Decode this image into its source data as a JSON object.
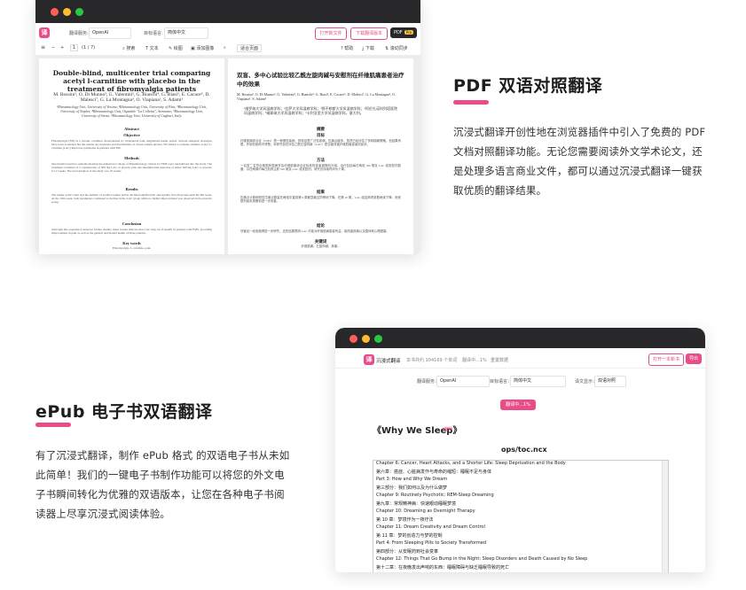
{
  "pdf_window": {
    "toolbar": {
      "service_label": "翻译服务:",
      "service_value": "OpenAI",
      "target_label": "目标语言:",
      "target_value": "简体中文",
      "open_file": "打开新文件",
      "download": "下载翻译版本",
      "pdf_pro": "PDF",
      "pro_badge": "Pro"
    },
    "subbar": {
      "page_current": "1",
      "page_total": "(1 / 7)",
      "tool_search": "搜索",
      "tool_text": "文本",
      "tool_draw": "绘图",
      "tool_highlight": "添加图像",
      "zoom_value": "适合页面",
      "help": "帮助",
      "download_icon_label": "下载",
      "sync": "滚动同步"
    },
    "left_page": {
      "title": "Double-blind, multicenter trial comparing acetyl l-carnitine with placebo in the treatment of fibromyalgia patients",
      "authors": "M. Rossini¹, O. Di Munno², G. Valentini³, G. Bianchi⁴, G. Biasi⁵, E. Cacace⁶, D. Malesci⁷, G. La Montagna³, O. Viapiana¹, S. Adami¹",
      "affiliations": "¹Rheumatology Unit, University of Verona; ²Rheumatology Unit, University of Pisa; ³Rheumatology Unit, University of Naples; ⁴Rheumatology Unit, Ospedale \"La Colletta\", Arenzano; ⁵Rheumatology Unit, University of Siena; ⁶Rheumatology Unit, University of Cagliari, Italy.",
      "abstract_head": "Abstract",
      "objective_head": "Objective",
      "objective_text": "Fibromyalgia (FM) is a chronic condition characterized by widespread pain, heightened tender points. Several analgesic strategies have been evaluated but the results are moderate and mechanisms of action remain unclear. We aimed to evaluate whether acetyl L-carnitine (LAC) improves symptoms in patients with FM.",
      "methods_head": "Methods",
      "methods_text": "One hundred and two patients meeting the American College of Rheumatology criteria for FMS were randomized into the study. The treatment consisted of 2 capsules/day of 500 mg LAC or placebo plus one intramuscular injection of either 500 mg LAC or placebo for 2 weeks. The total duration of the study was 10 weeks.",
      "results_head": "Results",
      "results_text": "The tender point count and the number of positive tender points declined significantly and equally in both groups until the 6th week. At the 10th week, both parameters continued to decline in the LAC group while no further improvement was observed in the placebo group.",
      "conclusion_head": "Conclusion",
      "conclusion_text": "Although this experience deserves further studies, these results indicate that LAC may be of benefit in patients with FMS, providing improvement in pain as well as the general and mental health of these patients.",
      "keywords_head": "Key words",
      "keywords_text": "Fibromyalgia, L-carnitine, pain."
    },
    "right_page": {
      "title": "双盲、多中心试验比较乙酰左旋肉碱与安慰剂在纤维肌痛患者治疗中的效果",
      "authors": "M. Rossini¹, O. Di Munno², G. Valentini³, G. Bianchi⁴, G. Biasi⁵, E. Cacace⁶, D. Malesci⁷, G. La Montagna³, O. Viapiana¹, S. Adami¹",
      "affiliations": "¹维罗纳大学风湿病学科；²比萨大学风湿病学科；³那不勒斯大学风湿病学科；⁴阿伦扎诺科列塔医院风湿病学科；⁵锡耶纳大学风湿病学科；⁶卡利亚里大学风湿病学科，意大利。",
      "abstract_head": "摘要",
      "objective_head": "目标",
      "objective_text": "纤维肌痛综合征（FMS）是一种慢性疾病，其特征是广泛性疼痛、压痛点增多。虽然已经评估了多种镇痛策略，但结果有限，作用机制尚不清楚。本研究旨在评估乙酰左旋肉碱（LAC）是否能改善纤维肌痛患者的症状。",
      "methods_head": "方法",
      "methods_text": "一百零二名符合美国风湿病学会纤维肌痛综合征标准的患者被随机分组。治疗包括每日两粒 500 毫克 LAC 或安慰剂胶囊，并在两周内每日肌肉注射 500 毫克 LAC 或安慰剂。研究总持续时间为十周。",
      "results_head": "结果",
      "results_text": "压痛点计数和阳性压痛点数量在两组中直到第 6 周都显著且同等地下降。在第 10 周，LAC 组这两项参数继续下降，而安慰剂组未观察到进一步改善。",
      "conclusion_head": "结论",
      "conclusion_text": "尽管这一经验值得进一步研究，这些结果表明 LAC 可能对纤维肌痛患者有益，能改善疼痛以及整体和心理健康。",
      "keywords_head": "关键词",
      "keywords_text": "纤维肌痛、左旋肉碱、疼痛。"
    }
  },
  "pdf_section": {
    "heading": "PDF 双语对照翻译",
    "para_lines": [
      "沉浸式翻译开创性地在浏览器插件中引入了免费的 PDF",
      "文档对照翻译功能。无论您需要阅读外文学术论文，还",
      "是处理多语言商业文件，都可以通过沉浸式翻译一键获",
      "取优质的翻译结果。"
    ]
  },
  "epub_section": {
    "heading": "ePub 电子书双语翻译",
    "para_lines": [
      "有了沉浸式翻译，制作 ePub 格式 的双语电子书从未如",
      "此简单！我们的一键电子书制作功能可以将您的外文电",
      "子书瞬间转化为优雅的双语版本，让您在各种电子书阅",
      "读器上尽享沉浸式阅读体验。"
    ]
  },
  "epub_window": {
    "app_name": "沉浸式翻译",
    "nav_info": "本书共约 104169 个单词",
    "nav_progress": "翻译中...1%",
    "nav_stop": "重置数据",
    "open_new": "打开一本新书",
    "export": "导出",
    "service_label": "翻译服务：",
    "service_value": "OpenAI",
    "target_label": "目标语言：",
    "target_value": "简体中文",
    "display_label": "译文显示：",
    "display_value": "双语对照",
    "progress_button": "翻译中...1%",
    "book_title": "《Why We Sleep》",
    "book_tag": "编辑",
    "toc_file": "ops/toc.ncx",
    "toc_items": [
      "Chapter 6: Cancer, Heart Attacks, and a Shorter Life: Sleep Deprivation and the Body",
      "第六章：癌症、心脏病发作与寿命的缩短：睡眠不足与身体",
      "Part 3: How and Why We Dream",
      "第三部分：我们如何以及为什么做梦",
      "Chapter 9: Routinely Psychotic: REM-Sleep Dreaming",
      "第九章：常规精神病：快速眼动睡眠梦境",
      "Chapter 10: Dreaming as Overnight Therapy",
      "第 10 章：梦境作为一夜疗法",
      "Chapter 11: Dream Creativity and Dream Control",
      "第 11 章：梦的创造力与梦的控制",
      "Part 4: From Sleeping Pills to Society Transformed",
      "第四部分：从安眠药到社会变革",
      "Chapter 12: Things That Go Bump in the Night: Sleep Disorders and Death Caused by No Sleep",
      "第十二章：在夜晚发出声响的东西：睡眠障碍与缺乏睡眠导致的死亡"
    ]
  },
  "colors": {
    "accent": "#ea4c89",
    "titlebar": "#28282b"
  }
}
